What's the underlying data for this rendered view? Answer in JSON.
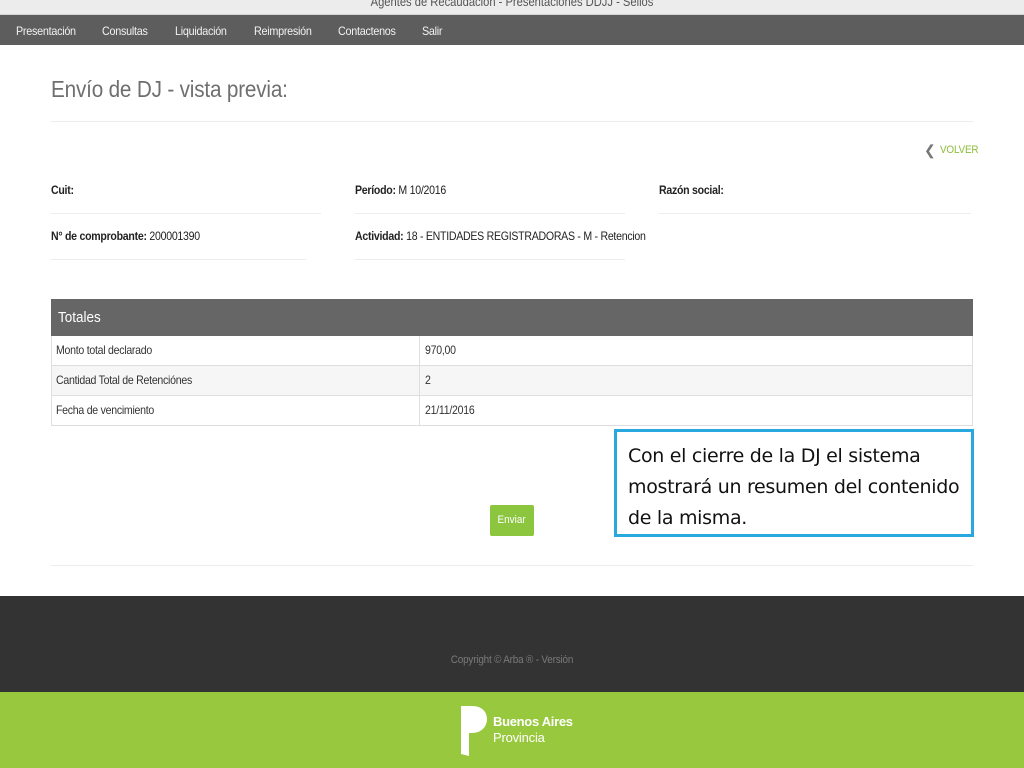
{
  "window": {
    "title": "Agentes de Recaudación - Presentaciones DDJJ - Sellos"
  },
  "nav": {
    "items": [
      {
        "label": "Presentación"
      },
      {
        "label": "Consultas"
      },
      {
        "label": "Liquidación"
      },
      {
        "label": "Reimpresión"
      },
      {
        "label": "Contactenos"
      },
      {
        "label": "Salir"
      }
    ]
  },
  "page": {
    "title": "Envío de DJ - vista previa:",
    "back_label": "VOLVER",
    "back_icon": "chevron-left-icon"
  },
  "fields": {
    "cuit": {
      "label": "Cuit:",
      "value": ""
    },
    "periodo": {
      "label": "Período:",
      "value": "M 10/2016"
    },
    "razon_social": {
      "label": "Razón social:",
      "value": ""
    },
    "comprobante": {
      "label": "N° de comprobante:",
      "value": "200001390"
    },
    "actividad": {
      "label": "Actividad:",
      "value": "18 - ENTIDADES REGISTRADORAS - M - Retencion"
    }
  },
  "totales": {
    "header": "Totales",
    "rows": [
      {
        "label": "Monto total declarado",
        "value": "970,00"
      },
      {
        "label": "Cantidad Total de Retenciónes",
        "value": "2"
      },
      {
        "label": "Fecha de vencimiento",
        "value": "21/11/2016"
      }
    ]
  },
  "actions": {
    "submit_label": "Enviar"
  },
  "callout": {
    "text": "Con el cierre de la DJ el sistema mostrará un resumen del contenido de la misma."
  },
  "footer": {
    "copyright": "Copyright © Arba ® - Versión",
    "logo_line1": "Buenos Aires",
    "logo_line2": "Provincia"
  },
  "colors": {
    "nav_bg": "#5d5d5d",
    "table_header_bg": "#666666",
    "accent_green": "#8cc63f",
    "footer_dark": "#333333",
    "footer_green": "#97c83d",
    "callout_border": "#29a8e0"
  }
}
